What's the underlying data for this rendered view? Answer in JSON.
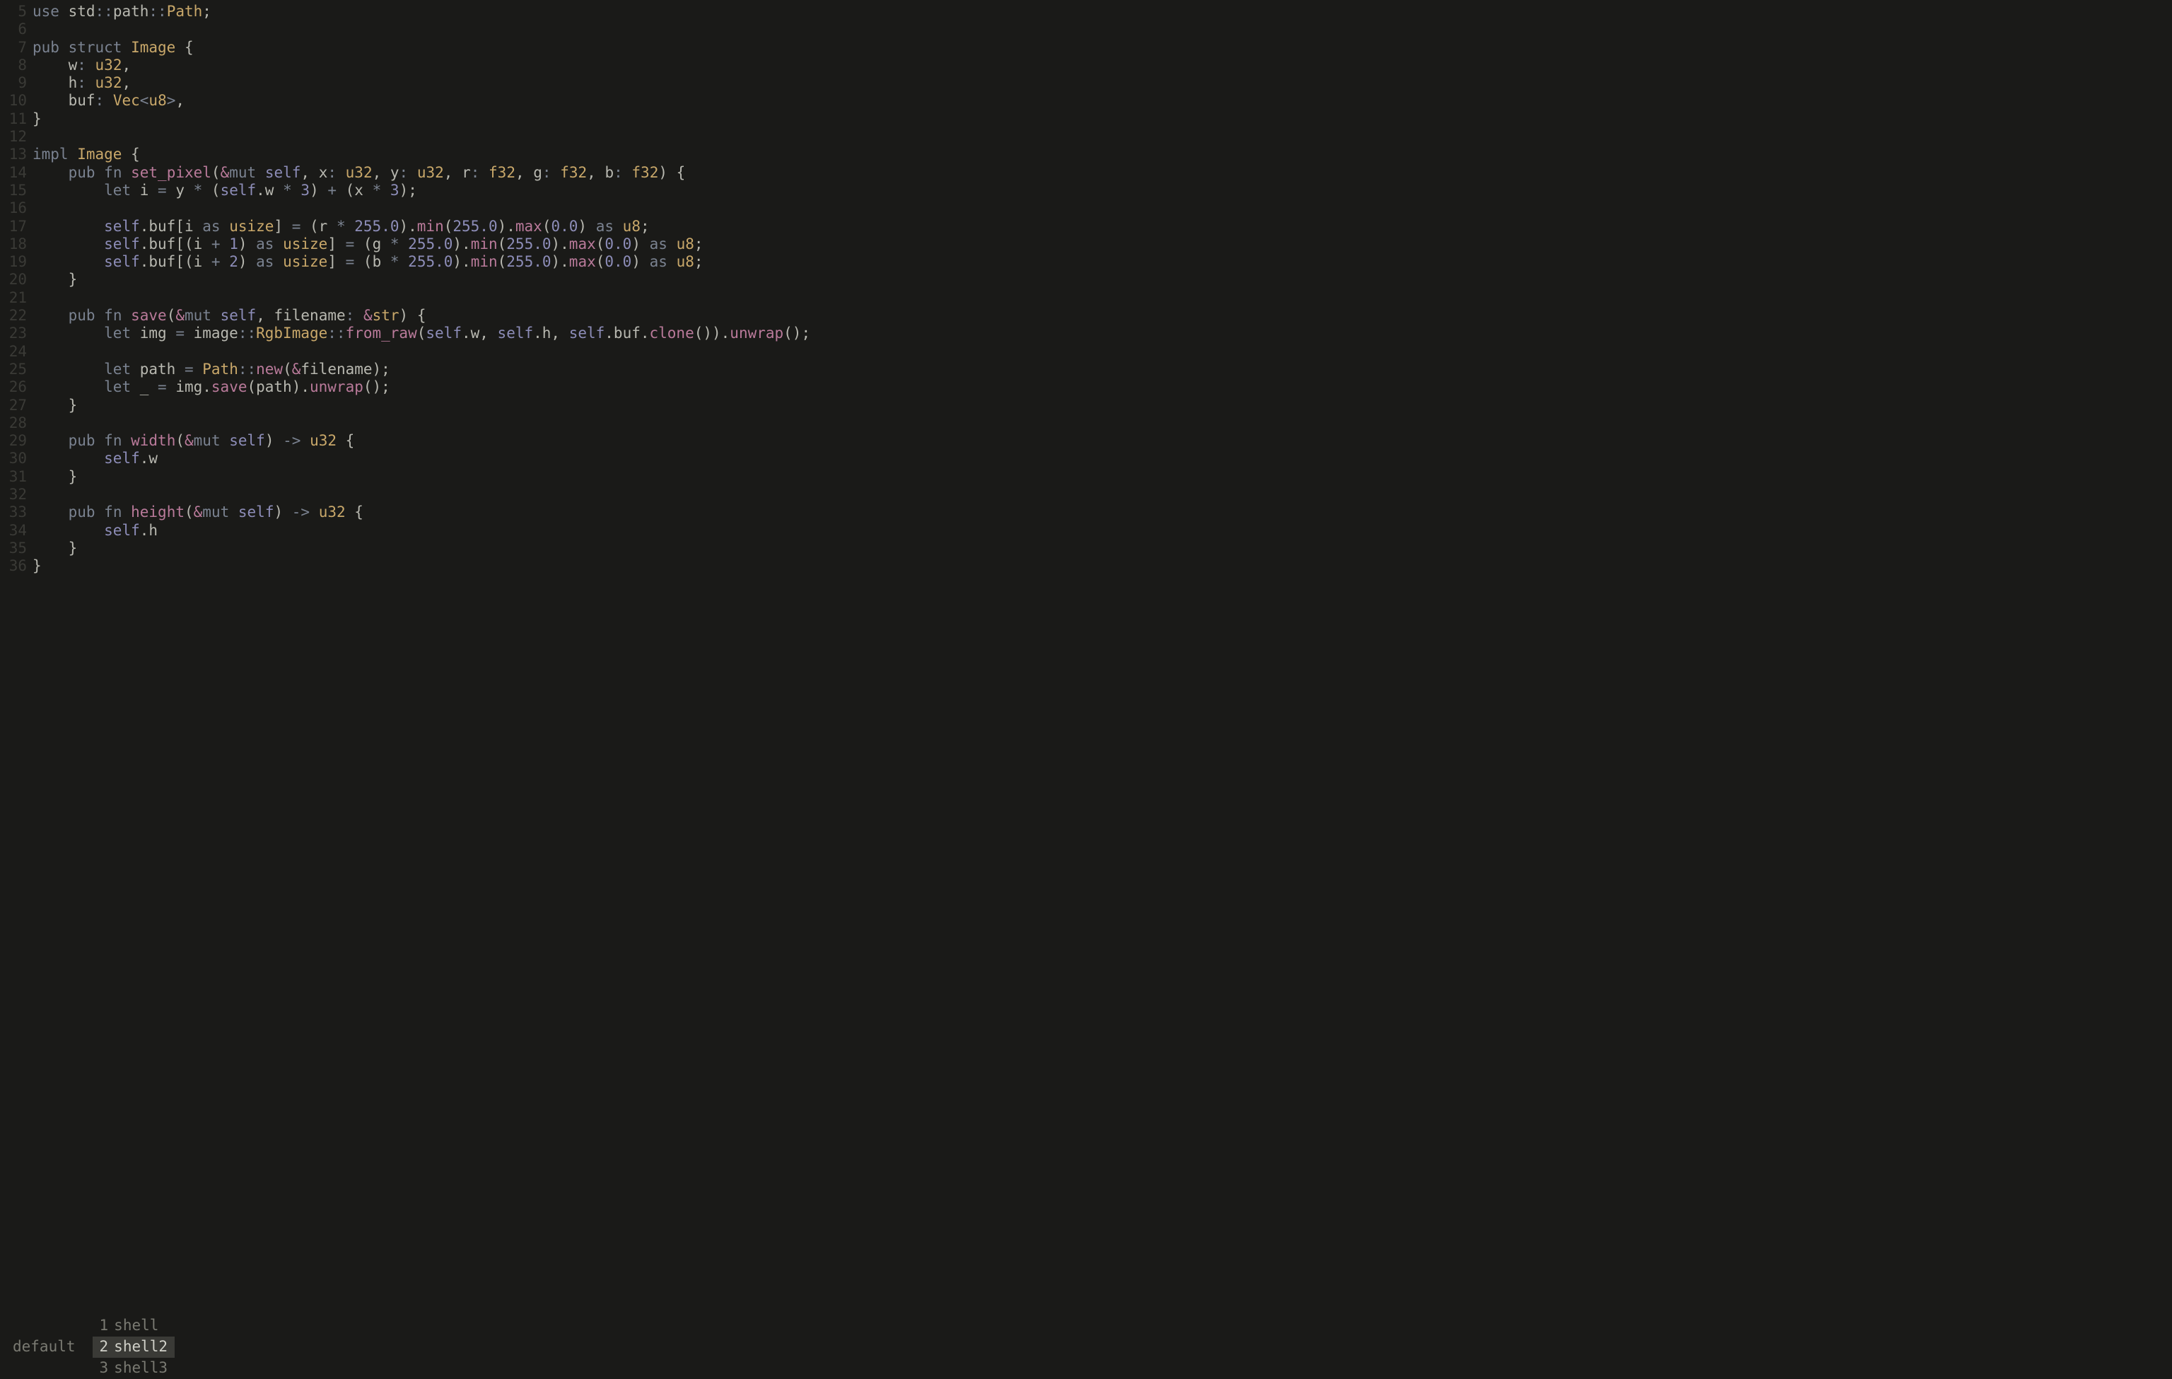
{
  "gutter": {
    "start": 5,
    "end": 36
  },
  "code_lines": [
    [
      [
        "kw",
        "use"
      ],
      [
        "punc",
        " std"
      ],
      [
        "op",
        "::"
      ],
      [
        "punc",
        "path"
      ],
      [
        "op",
        "::"
      ],
      [
        "ty",
        "Path"
      ],
      [
        "punc",
        ";"
      ]
    ],
    [],
    [
      [
        "kw",
        "pub"
      ],
      [
        "punc",
        " "
      ],
      [
        "kw",
        "struct"
      ],
      [
        "punc",
        " "
      ],
      [
        "ty",
        "Image"
      ],
      [
        "punc",
        " {"
      ]
    ],
    [
      [
        "punc",
        "    w"
      ],
      [
        "op",
        ":"
      ],
      [
        "punc",
        " "
      ],
      [
        "ty",
        "u32"
      ],
      [
        "punc",
        ","
      ]
    ],
    [
      [
        "punc",
        "    h"
      ],
      [
        "op",
        ":"
      ],
      [
        "punc",
        " "
      ],
      [
        "ty",
        "u32"
      ],
      [
        "punc",
        ","
      ]
    ],
    [
      [
        "punc",
        "    buf"
      ],
      [
        "op",
        ":"
      ],
      [
        "punc",
        " "
      ],
      [
        "ty",
        "Vec"
      ],
      [
        "op",
        "<"
      ],
      [
        "ty",
        "u8"
      ],
      [
        "op",
        ">"
      ],
      [
        "punc",
        ","
      ]
    ],
    [
      [
        "punc",
        "}"
      ]
    ],
    [],
    [
      [
        "kw",
        "impl"
      ],
      [
        "punc",
        " "
      ],
      [
        "ty",
        "Image"
      ],
      [
        "punc",
        " {"
      ]
    ],
    [
      [
        "punc",
        "    "
      ],
      [
        "kw",
        "pub"
      ],
      [
        "punc",
        " "
      ],
      [
        "kw",
        "fn"
      ],
      [
        "punc",
        " "
      ],
      [
        "fnname",
        "set_pixel"
      ],
      [
        "punc",
        "("
      ],
      [
        "amp",
        "&"
      ],
      [
        "sp",
        "mut"
      ],
      [
        "punc",
        " "
      ],
      [
        "slf",
        "self"
      ],
      [
        "punc",
        ", x"
      ],
      [
        "op",
        ":"
      ],
      [
        "punc",
        " "
      ],
      [
        "ty",
        "u32"
      ],
      [
        "punc",
        ", y"
      ],
      [
        "op",
        ":"
      ],
      [
        "punc",
        " "
      ],
      [
        "ty",
        "u32"
      ],
      [
        "punc",
        ", r"
      ],
      [
        "op",
        ":"
      ],
      [
        "punc",
        " "
      ],
      [
        "ty",
        "f32"
      ],
      [
        "punc",
        ", g"
      ],
      [
        "op",
        ":"
      ],
      [
        "punc",
        " "
      ],
      [
        "ty",
        "f32"
      ],
      [
        "punc",
        ", b"
      ],
      [
        "op",
        ":"
      ],
      [
        "punc",
        " "
      ],
      [
        "ty",
        "f32"
      ],
      [
        "punc",
        ") {"
      ]
    ],
    [
      [
        "punc",
        "        "
      ],
      [
        "kw",
        "let"
      ],
      [
        "punc",
        " i "
      ],
      [
        "op",
        "="
      ],
      [
        "punc",
        " y "
      ],
      [
        "op",
        "*"
      ],
      [
        "punc",
        " ("
      ],
      [
        "slf",
        "self"
      ],
      [
        "punc",
        ".w "
      ],
      [
        "op",
        "*"
      ],
      [
        "punc",
        " "
      ],
      [
        "num",
        "3"
      ],
      [
        "punc",
        ") "
      ],
      [
        "op",
        "+"
      ],
      [
        "punc",
        " (x "
      ],
      [
        "op",
        "*"
      ],
      [
        "punc",
        " "
      ],
      [
        "num",
        "3"
      ],
      [
        "punc",
        ");"
      ]
    ],
    [],
    [
      [
        "punc",
        "        "
      ],
      [
        "slf",
        "self"
      ],
      [
        "punc",
        ".buf[i "
      ],
      [
        "kw",
        "as"
      ],
      [
        "punc",
        " "
      ],
      [
        "ty",
        "usize"
      ],
      [
        "punc",
        "] "
      ],
      [
        "op",
        "="
      ],
      [
        "punc",
        " (r "
      ],
      [
        "op",
        "*"
      ],
      [
        "punc",
        " "
      ],
      [
        "num",
        "255.0"
      ],
      [
        "punc",
        ")."
      ],
      [
        "fnname",
        "min"
      ],
      [
        "punc",
        "("
      ],
      [
        "num",
        "255.0"
      ],
      [
        "punc",
        ")."
      ],
      [
        "fnname",
        "max"
      ],
      [
        "punc",
        "("
      ],
      [
        "num",
        "0.0"
      ],
      [
        "punc",
        ") "
      ],
      [
        "kw",
        "as"
      ],
      [
        "punc",
        " "
      ],
      [
        "ty",
        "u8"
      ],
      [
        "punc",
        ";"
      ]
    ],
    [
      [
        "punc",
        "        "
      ],
      [
        "slf",
        "self"
      ],
      [
        "punc",
        ".buf[(i "
      ],
      [
        "op",
        "+"
      ],
      [
        "punc",
        " "
      ],
      [
        "num",
        "1"
      ],
      [
        "punc",
        ") "
      ],
      [
        "kw",
        "as"
      ],
      [
        "punc",
        " "
      ],
      [
        "ty",
        "usize"
      ],
      [
        "punc",
        "] "
      ],
      [
        "op",
        "="
      ],
      [
        "punc",
        " (g "
      ],
      [
        "op",
        "*"
      ],
      [
        "punc",
        " "
      ],
      [
        "num",
        "255.0"
      ],
      [
        "punc",
        ")."
      ],
      [
        "fnname",
        "min"
      ],
      [
        "punc",
        "("
      ],
      [
        "num",
        "255.0"
      ],
      [
        "punc",
        ")."
      ],
      [
        "fnname",
        "max"
      ],
      [
        "punc",
        "("
      ],
      [
        "num",
        "0.0"
      ],
      [
        "punc",
        ") "
      ],
      [
        "kw",
        "as"
      ],
      [
        "punc",
        " "
      ],
      [
        "ty",
        "u8"
      ],
      [
        "punc",
        ";"
      ]
    ],
    [
      [
        "punc",
        "        "
      ],
      [
        "slf",
        "self"
      ],
      [
        "punc",
        ".buf[(i "
      ],
      [
        "op",
        "+"
      ],
      [
        "punc",
        " "
      ],
      [
        "num",
        "2"
      ],
      [
        "punc",
        ") "
      ],
      [
        "kw",
        "as"
      ],
      [
        "punc",
        " "
      ],
      [
        "ty",
        "usize"
      ],
      [
        "punc",
        "] "
      ],
      [
        "op",
        "="
      ],
      [
        "punc",
        " (b "
      ],
      [
        "op",
        "*"
      ],
      [
        "punc",
        " "
      ],
      [
        "num",
        "255.0"
      ],
      [
        "punc",
        ")."
      ],
      [
        "fnname",
        "min"
      ],
      [
        "punc",
        "("
      ],
      [
        "num",
        "255.0"
      ],
      [
        "punc",
        ")."
      ],
      [
        "fnname",
        "max"
      ],
      [
        "punc",
        "("
      ],
      [
        "num",
        "0.0"
      ],
      [
        "punc",
        ") "
      ],
      [
        "kw",
        "as"
      ],
      [
        "punc",
        " "
      ],
      [
        "ty",
        "u8"
      ],
      [
        "punc",
        ";"
      ]
    ],
    [
      [
        "punc",
        "    }"
      ]
    ],
    [],
    [
      [
        "punc",
        "    "
      ],
      [
        "kw",
        "pub"
      ],
      [
        "punc",
        " "
      ],
      [
        "kw",
        "fn"
      ],
      [
        "punc",
        " "
      ],
      [
        "fnname",
        "save"
      ],
      [
        "punc",
        "("
      ],
      [
        "amp",
        "&"
      ],
      [
        "sp",
        "mut"
      ],
      [
        "punc",
        " "
      ],
      [
        "slf",
        "self"
      ],
      [
        "punc",
        ", filename"
      ],
      [
        "op",
        ":"
      ],
      [
        "punc",
        " "
      ],
      [
        "amp",
        "&"
      ],
      [
        "ty",
        "str"
      ],
      [
        "punc",
        ") {"
      ]
    ],
    [
      [
        "punc",
        "        "
      ],
      [
        "kw",
        "let"
      ],
      [
        "punc",
        " img "
      ],
      [
        "op",
        "="
      ],
      [
        "punc",
        " image"
      ],
      [
        "op",
        "::"
      ],
      [
        "ty",
        "RgbImage"
      ],
      [
        "op",
        "::"
      ],
      [
        "fnname",
        "from_raw"
      ],
      [
        "punc",
        "("
      ],
      [
        "slf",
        "self"
      ],
      [
        "punc",
        ".w, "
      ],
      [
        "slf",
        "self"
      ],
      [
        "punc",
        ".h, "
      ],
      [
        "slf",
        "self"
      ],
      [
        "punc",
        ".buf."
      ],
      [
        "fnname",
        "clone"
      ],
      [
        "punc",
        "())."
      ],
      [
        "fnname",
        "unwrap"
      ],
      [
        "punc",
        "();"
      ]
    ],
    [],
    [
      [
        "punc",
        "        "
      ],
      [
        "kw",
        "let"
      ],
      [
        "punc",
        " path "
      ],
      [
        "op",
        "="
      ],
      [
        "punc",
        " "
      ],
      [
        "ty",
        "Path"
      ],
      [
        "op",
        "::"
      ],
      [
        "fnname",
        "new"
      ],
      [
        "punc",
        "("
      ],
      [
        "amp",
        "&"
      ],
      [
        "punc",
        "filename);"
      ]
    ],
    [
      [
        "punc",
        "        "
      ],
      [
        "kw",
        "let"
      ],
      [
        "punc",
        " _ "
      ],
      [
        "op",
        "="
      ],
      [
        "punc",
        " img."
      ],
      [
        "fnname",
        "save"
      ],
      [
        "punc",
        "(path)."
      ],
      [
        "fnname",
        "unwrap"
      ],
      [
        "punc",
        "();"
      ]
    ],
    [
      [
        "punc",
        "    }"
      ]
    ],
    [],
    [
      [
        "punc",
        "    "
      ],
      [
        "kw",
        "pub"
      ],
      [
        "punc",
        " "
      ],
      [
        "kw",
        "fn"
      ],
      [
        "punc",
        " "
      ],
      [
        "fnname",
        "width"
      ],
      [
        "punc",
        "("
      ],
      [
        "amp",
        "&"
      ],
      [
        "sp",
        "mut"
      ],
      [
        "punc",
        " "
      ],
      [
        "slf",
        "self"
      ],
      [
        "punc",
        ") "
      ],
      [
        "arrow",
        "->"
      ],
      [
        "punc",
        " "
      ],
      [
        "ty",
        "u32"
      ],
      [
        "punc",
        " {"
      ]
    ],
    [
      [
        "punc",
        "        "
      ],
      [
        "slf",
        "self"
      ],
      [
        "punc",
        ".w"
      ]
    ],
    [
      [
        "punc",
        "    }"
      ]
    ],
    [],
    [
      [
        "punc",
        "    "
      ],
      [
        "kw",
        "pub"
      ],
      [
        "punc",
        " "
      ],
      [
        "kw",
        "fn"
      ],
      [
        "punc",
        " "
      ],
      [
        "fnname",
        "height"
      ],
      [
        "punc",
        "("
      ],
      [
        "amp",
        "&"
      ],
      [
        "sp",
        "mut"
      ],
      [
        "punc",
        " "
      ],
      [
        "slf",
        "self"
      ],
      [
        "punc",
        ") "
      ],
      [
        "arrow",
        "->"
      ],
      [
        "punc",
        " "
      ],
      [
        "ty",
        "u32"
      ],
      [
        "punc",
        " {"
      ]
    ],
    [
      [
        "punc",
        "        "
      ],
      [
        "slf",
        "self"
      ],
      [
        "punc",
        ".h"
      ]
    ],
    [
      [
        "punc",
        "    }"
      ]
    ],
    [
      [
        "punc",
        "}"
      ]
    ]
  ],
  "status": {
    "session": "default",
    "windows": [
      {
        "index": "1",
        "name": "shell",
        "active": false
      },
      {
        "index": "2",
        "name": "shell2",
        "active": true
      },
      {
        "index": "3",
        "name": "shell3",
        "active": false
      }
    ]
  }
}
